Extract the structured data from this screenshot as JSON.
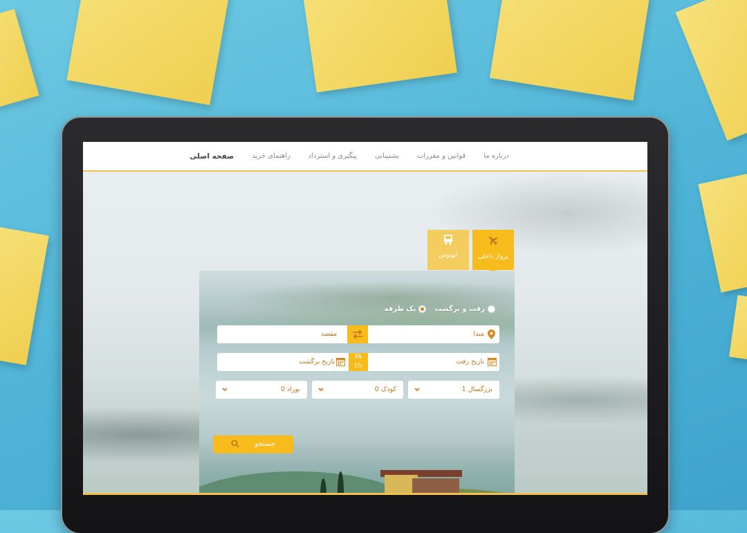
{
  "nav": {
    "items": [
      {
        "label": "صفحه اصلی"
      },
      {
        "label": "راهنمای خرید"
      },
      {
        "label": "پیگیری و استرداد"
      },
      {
        "label": "پشتیبانی"
      },
      {
        "label": "قوانین و مقررات"
      },
      {
        "label": "درباره ما"
      }
    ]
  },
  "tabs": {
    "flight": {
      "label": "پرواز داخلی",
      "icon": "airplane-icon"
    },
    "bus": {
      "label": "اتوبوس",
      "icon": "bus-icon"
    }
  },
  "trip_type": {
    "one_way": "یک طرفه",
    "round_trip": "رفت و برگشت",
    "selected": "one_way"
  },
  "form": {
    "origin_placeholder": "مبدا",
    "destination_placeholder": "مقصد",
    "departure_placeholder": "تاریخ رفت",
    "return_placeholder": "تاریخ برگشت",
    "calendar_fa": "FA",
    "calendar_en": "EN",
    "adults": "بزرگسال 1",
    "children": "کودک 0",
    "infants": "نوزاد 0",
    "search_label": "جستجو"
  },
  "colors": {
    "accent": "#f7bc1b",
    "accent_text": "#c6741d",
    "nav_active": "#444444"
  }
}
